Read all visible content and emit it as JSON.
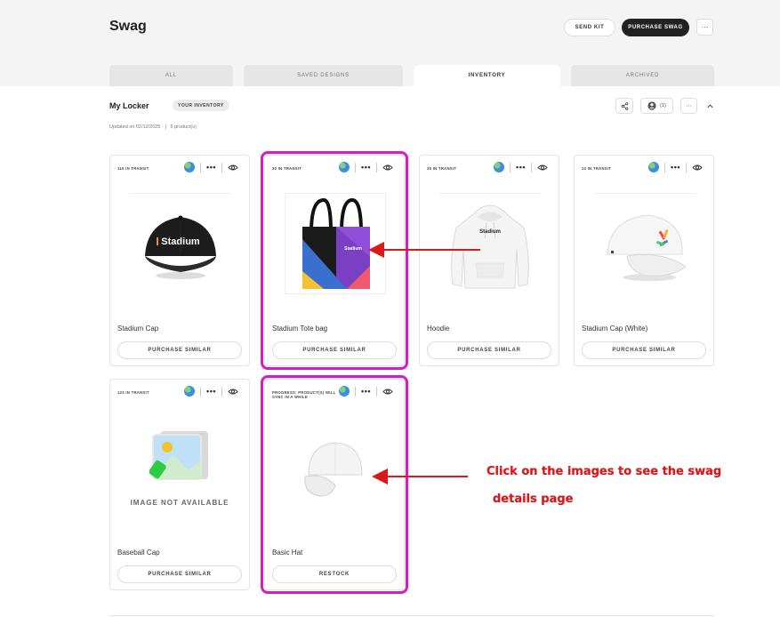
{
  "header": {
    "title": "Swag",
    "send_kit": "SEND KIT",
    "purchase_swag": "PURCHASE SWAG",
    "more": "···"
  },
  "tabs": [
    {
      "label": "ALL",
      "active": false
    },
    {
      "label": "SAVED DESIGNS",
      "active": false
    },
    {
      "label": "INVENTORY",
      "active": true
    },
    {
      "label": "ARCHIVED",
      "active": false
    }
  ],
  "locker": {
    "title": "My Locker",
    "badge": "YOUR INVENTORY",
    "updated": "Updated on 02/12/2025",
    "count": "6 product(s)",
    "user_count": "(1)",
    "more": "···"
  },
  "products": [
    {
      "transit": "115 IN TRANSIT",
      "name": "Stadium Cap",
      "button": "PURCHASE SIMILAR",
      "image": "black-cap",
      "highlighted": false
    },
    {
      "transit": "30 IN TRANSIT",
      "name": "Stadium Tote bag",
      "button": "PURCHASE SIMILAR",
      "image": "tote-bag",
      "highlighted": true
    },
    {
      "transit": "35 IN TRANSIT",
      "name": "Hoodie",
      "button": "PURCHASE SIMILAR",
      "image": "white-hoodie",
      "highlighted": false
    },
    {
      "transit": "10 IN TRANSIT",
      "name": "Stadium Cap (White)",
      "button": "PURCHASE SIMILAR",
      "image": "white-cap",
      "highlighted": false
    },
    {
      "transit": "123 IN TRANSIT",
      "name": "Baseball Cap",
      "button": "PURCHASE SIMILAR",
      "image": "placeholder",
      "image_text": "IMAGE NOT AVAILABLE",
      "highlighted": false
    },
    {
      "transit": "PROGRESS: PRODUCT(S) WILL SYNC IN A WHILE",
      "name": "Basic Hat",
      "button": "RESTOCK",
      "image": "basic-hat",
      "highlighted": true
    }
  ],
  "annotation": {
    "line1": "Click on the images to see the swag",
    "line2": "details page",
    "color": "#d9191c"
  },
  "colors": {
    "highlight": "#d21ec4",
    "dark_button": "#222222",
    "annotation": "#d9191c"
  }
}
